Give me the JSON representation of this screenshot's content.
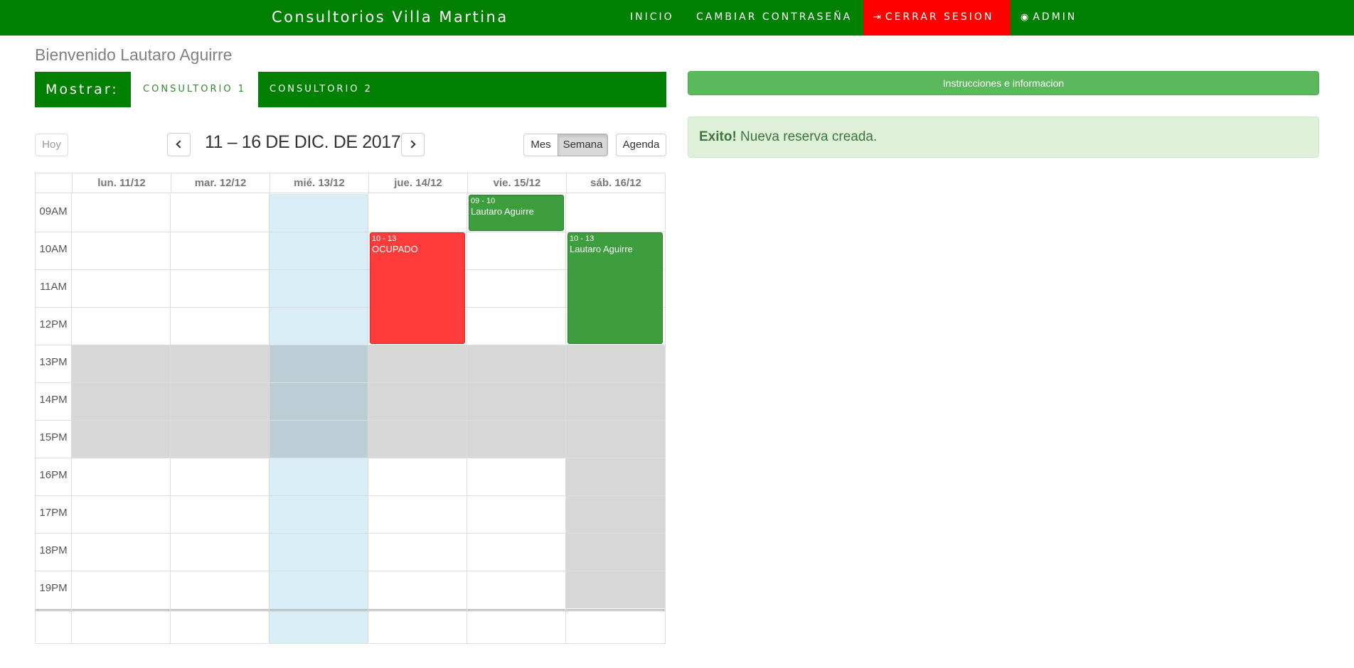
{
  "navbar": {
    "brand": "Consultorios Villa Martina",
    "items": {
      "inicio": "INICIO",
      "cambiar": "CAMBIAR CONTRASEÑA",
      "cerrar": "CERRAR SESION",
      "admin": "ADMIN"
    },
    "logout_color": "#ff0000",
    "bar_color": "#008000"
  },
  "welcome": "Bienvenido Lautaro Aguirre",
  "mostrar": {
    "label": "Mostrar:",
    "tabs": [
      "CONSULTORIO 1",
      "CONSULTORIO 2"
    ]
  },
  "info_button": "Instrucciones e informacion",
  "alert": {
    "strong": "Exito!",
    "text": " Nueva reserva creada."
  },
  "toolbar": {
    "today": "Hoy",
    "title": "11 – 16 DE DIC. DE 2017",
    "views": [
      "Mes",
      "Semana",
      "Agenda"
    ],
    "active_view": "Semana"
  },
  "calendar": {
    "days": [
      "lun. 11/12",
      "mar. 12/12",
      "mié. 13/12",
      "jue. 14/12",
      "vie. 15/12",
      "sáb. 16/12"
    ],
    "today_index": 2,
    "hours": [
      "09AM",
      "10AM",
      "11AM",
      "12PM",
      "13PM",
      "14PM",
      "15PM",
      "16PM",
      "17PM",
      "18PM",
      "19PM"
    ],
    "events": [
      {
        "day": "jue. 14/12",
        "time": "10 - 13",
        "title": "OCUPADO",
        "color": "#ff3b3b"
      },
      {
        "day": "vie. 15/12",
        "time": "09 - 10",
        "title": "Lautaro Aguirre",
        "color": "#3c9e3c"
      },
      {
        "day": "sáb. 16/12",
        "time": "10 - 13",
        "title": "Lautaro Aguirre",
        "color": "#3c9e3c"
      }
    ],
    "colors": {
      "today": "#d9edf7",
      "unavailable": "#d7d7d7"
    }
  }
}
